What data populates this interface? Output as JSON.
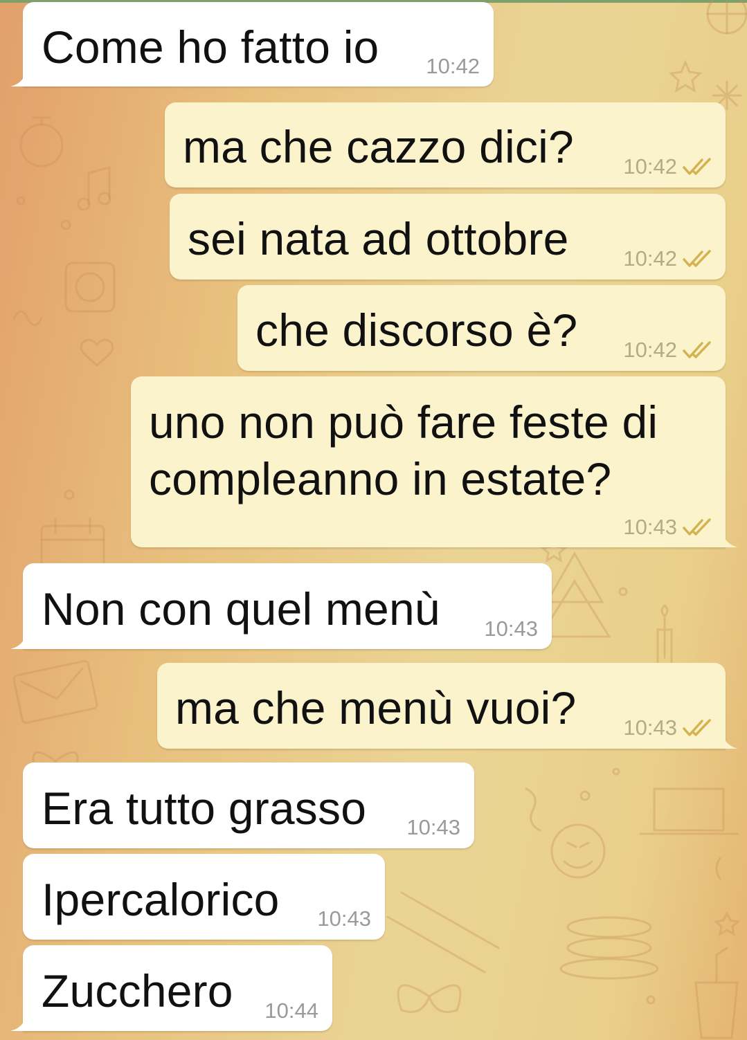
{
  "theme": {
    "incoming_bubble": "#ffffff",
    "outgoing_bubble": "#fbf3cb",
    "check_color": "#d5b250"
  },
  "messages": [
    {
      "direction": "incoming",
      "text": "Come ho fatto io",
      "time": "10:42",
      "icon": "none"
    },
    {
      "direction": "outgoing",
      "text": "ma che cazzo dici?",
      "time": "10:42",
      "icon": "double-check-icon"
    },
    {
      "direction": "outgoing",
      "text": "sei nata ad ottobre",
      "time": "10:42",
      "icon": "double-check-icon"
    },
    {
      "direction": "outgoing",
      "text": "che discorso è?",
      "time": "10:42",
      "icon": "double-check-icon"
    },
    {
      "direction": "outgoing",
      "text": "uno non può fare feste di compleanno in estate?",
      "time": "10:43",
      "icon": "double-check-icon"
    },
    {
      "direction": "incoming",
      "text": "Non con quel menù",
      "time": "10:43",
      "icon": "none"
    },
    {
      "direction": "outgoing",
      "text": "ma che menù vuoi?",
      "time": "10:43",
      "icon": "double-check-icon"
    },
    {
      "direction": "incoming",
      "text": "Era tutto grasso",
      "time": "10:43",
      "icon": "none"
    },
    {
      "direction": "incoming",
      "text": "Ipercalorico",
      "time": "10:43",
      "icon": "none"
    },
    {
      "direction": "incoming",
      "text": "Zucchero",
      "time": "10:44",
      "icon": "none"
    }
  ]
}
